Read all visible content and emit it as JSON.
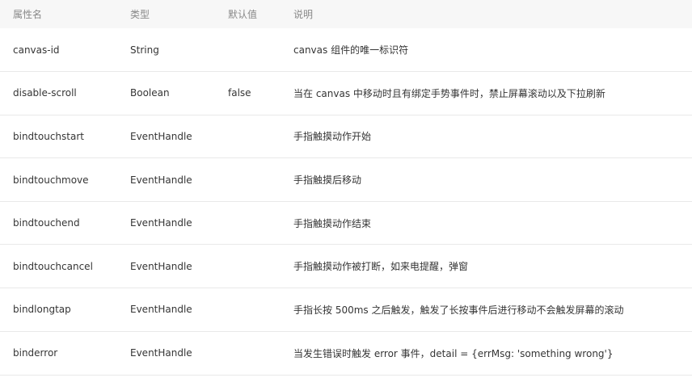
{
  "table": {
    "headers": [
      "属性名",
      "类型",
      "默认值",
      "说明"
    ],
    "rows": [
      {
        "name": "canvas-id",
        "type": "String",
        "default": "",
        "description": "canvas 组件的唯一标识符"
      },
      {
        "name": "disable-scroll",
        "type": "Boolean",
        "default": "false",
        "description": "当在 canvas 中移动时且有绑定手势事件时，禁止屏幕滚动以及下拉刷新"
      },
      {
        "name": "bindtouchstart",
        "type": "EventHandle",
        "default": "",
        "description": "手指触摸动作开始"
      },
      {
        "name": "bindtouchmove",
        "type": "EventHandle",
        "default": "",
        "description": "手指触摸后移动"
      },
      {
        "name": "bindtouchend",
        "type": "EventHandle",
        "default": "",
        "description": "手指触摸动作结束"
      },
      {
        "name": "bindtouchcancel",
        "type": "EventHandle",
        "default": "",
        "description": "手指触摸动作被打断，如来电提醒，弹窗"
      },
      {
        "name": "bindlongtap",
        "type": "EventHandle",
        "default": "",
        "description": "手指长按 500ms 之后触发，触发了长按事件后进行移动不会触发屏幕的滚动"
      },
      {
        "name": "binderror",
        "type": "EventHandle",
        "default": "",
        "description": "当发生错误时触发 error 事件，detail = {errMsg: 'something wrong'}"
      }
    ]
  }
}
